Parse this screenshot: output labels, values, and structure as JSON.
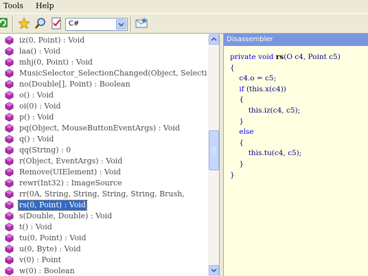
{
  "menu": {
    "tools": "Tools",
    "help": "Help"
  },
  "toolbar": {
    "language_value": "C#"
  },
  "tree": {
    "items": [
      {
        "label": "iz(0, Point) : Void"
      },
      {
        "label": "laa() : Void"
      },
      {
        "label": "mhj(0, Point) : Void"
      },
      {
        "label": "MusicSelector_SelectionChanged(Object, Selecti"
      },
      {
        "label": "no(Double[], Point) : Boolean"
      },
      {
        "label": "o() : Void"
      },
      {
        "label": "oi(0) : Void"
      },
      {
        "label": "p() : Void"
      },
      {
        "label": "pq(Object, MouseButtonEventArgs) : Void"
      },
      {
        "label": "q() : Void"
      },
      {
        "label": "qq(String) : 0"
      },
      {
        "label": "r(Object, EventArgs) : Void"
      },
      {
        "label": "Remove(UIElement) : Void"
      },
      {
        "label": "rewr(Int32) : ImageSource"
      },
      {
        "label": "rr(0A, String, String, String, String, Brush,"
      },
      {
        "label": "rs(0, Point) : Void",
        "selected": true
      },
      {
        "label": "s(Double, Double) : Void"
      },
      {
        "label": "t() : Void"
      },
      {
        "label": "tu(0, Point) : Void"
      },
      {
        "label": "u(0, Byte) : Void"
      },
      {
        "label": "v(0) : Point"
      },
      {
        "label": "w(0) : Boolean"
      }
    ]
  },
  "disassembler": {
    "title": "Disassembler",
    "code": {
      "l1_private": "private",
      "l1_void": "void",
      "l1_name": "rs",
      "l1_rest": "(O c4, Point c5)",
      "l2": "{",
      "l3": "c4.o = c5;",
      "l4_if": "if",
      "l4_rest": "(this.x(c4))",
      "l5": "{",
      "l6": "this.iz(c4, c5);",
      "l7": "}",
      "l8": "else",
      "l9": "{",
      "l10": "this.tu(c4, c5);",
      "l11": "}",
      "l12": "}"
    }
  },
  "colors": {
    "selection": "#316ac5",
    "titlebar": "#7a96df",
    "code_background": "#ffffe1",
    "keyword": "#0000ff"
  },
  "icons": [
    "refresh-icon",
    "star-icon",
    "search-icon",
    "checklist-icon",
    "mail-icon",
    "method-icon"
  ]
}
